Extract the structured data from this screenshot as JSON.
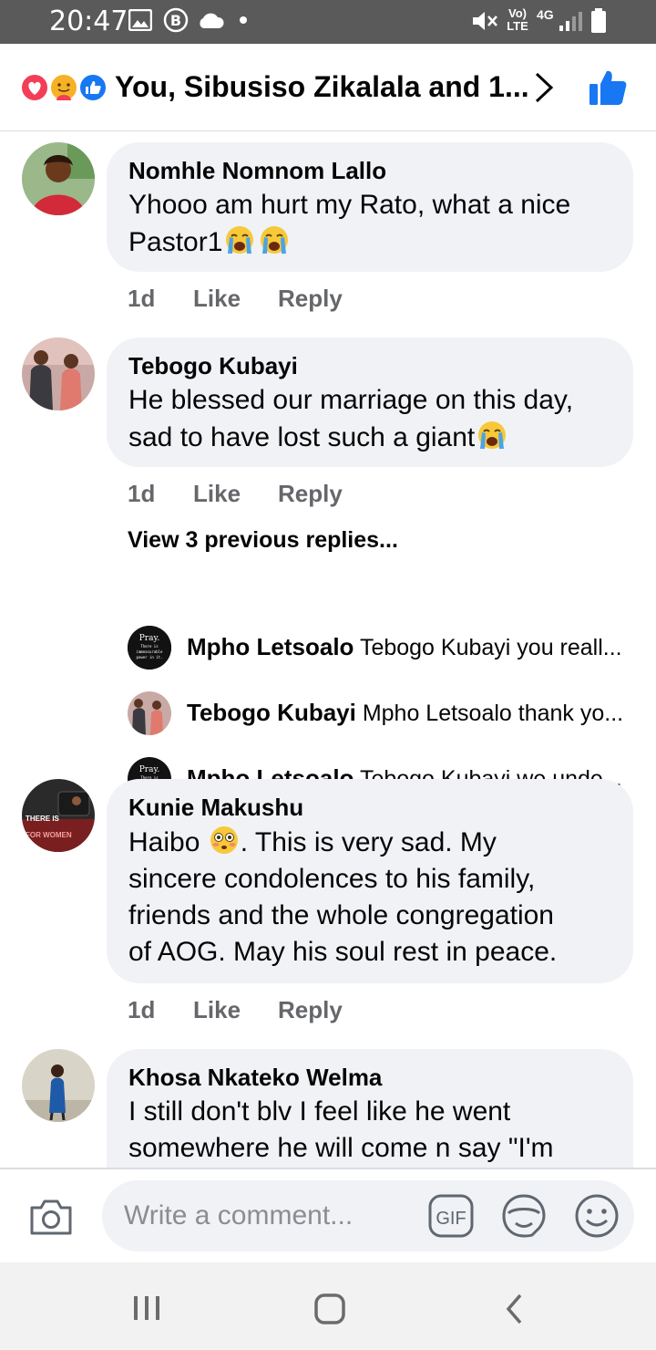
{
  "status_bar": {
    "time": "20:47",
    "signal_label_top": "Vo)",
    "signal_label_bottom": "LTE",
    "network": "4G",
    "icons": [
      "gallery-icon",
      "b-icon",
      "cloud-icon",
      "dot-icon",
      "mute-icon",
      "signal-icon",
      "battery-icon"
    ]
  },
  "header": {
    "reactions_text": "You, Sibusiso Zikalala and 1...",
    "reaction_icons": [
      "love-reaction-icon",
      "care-reaction-icon",
      "like-reaction-icon"
    ]
  },
  "comments": [
    {
      "author": "Nomhle Nomnom Lallo",
      "line1": "Yhooo am hurt my Rato, what a nice",
      "line2": "Pastor1",
      "emoji_count": 2,
      "time": "1d",
      "like": "Like",
      "reply": "Reply"
    },
    {
      "author": "Tebogo Kubayi",
      "line1": "He blessed our marriage on this day,",
      "line2": "sad to have lost such a giant",
      "emoji_count": 1,
      "time": "1d",
      "like": "Like",
      "reply": "Reply",
      "view_replies": "View 3 previous replies...",
      "replies": [
        {
          "author": "Mpho Letsoalo",
          "text": "Tebogo Kubayi you reall..."
        },
        {
          "author": "Tebogo Kubayi",
          "text": "Mpho Letsoalo thank yo..."
        },
        {
          "author": "Mpho Letsoalo",
          "text": "Tebogo Kubayi we unde..."
        }
      ]
    },
    {
      "author": "Kunie Makushu",
      "line1_a": "Haibo",
      "line1_b": ". This is very sad. My",
      "line2": "sincere condolences to his family,",
      "line3": "friends and the whole congregation",
      "line4": "of AOG. May his soul rest in peace.",
      "time": "1d",
      "like": "Like",
      "reply": "Reply"
    },
    {
      "author": "Khosa Nkateko Welma",
      "line1": "I still don't blv I feel like he went",
      "line2": "somewhere he will come n say \"I'm"
    }
  ],
  "avatar_text": {
    "pray_title": "Pray.",
    "pray_sub1": "There is",
    "pray_sub2": "immeasurable",
    "pray_sub3": "power in it.",
    "kunie_line1": "THERE IS",
    "kunie_line2": "FOR WOMEN"
  },
  "composer": {
    "placeholder": "Write a comment...",
    "gif_label": "GIF"
  },
  "colors": {
    "accent": "#1877f2",
    "bubble": "#f0f2f5",
    "meta": "#65676b",
    "status_bar": "#5a5a5a"
  }
}
